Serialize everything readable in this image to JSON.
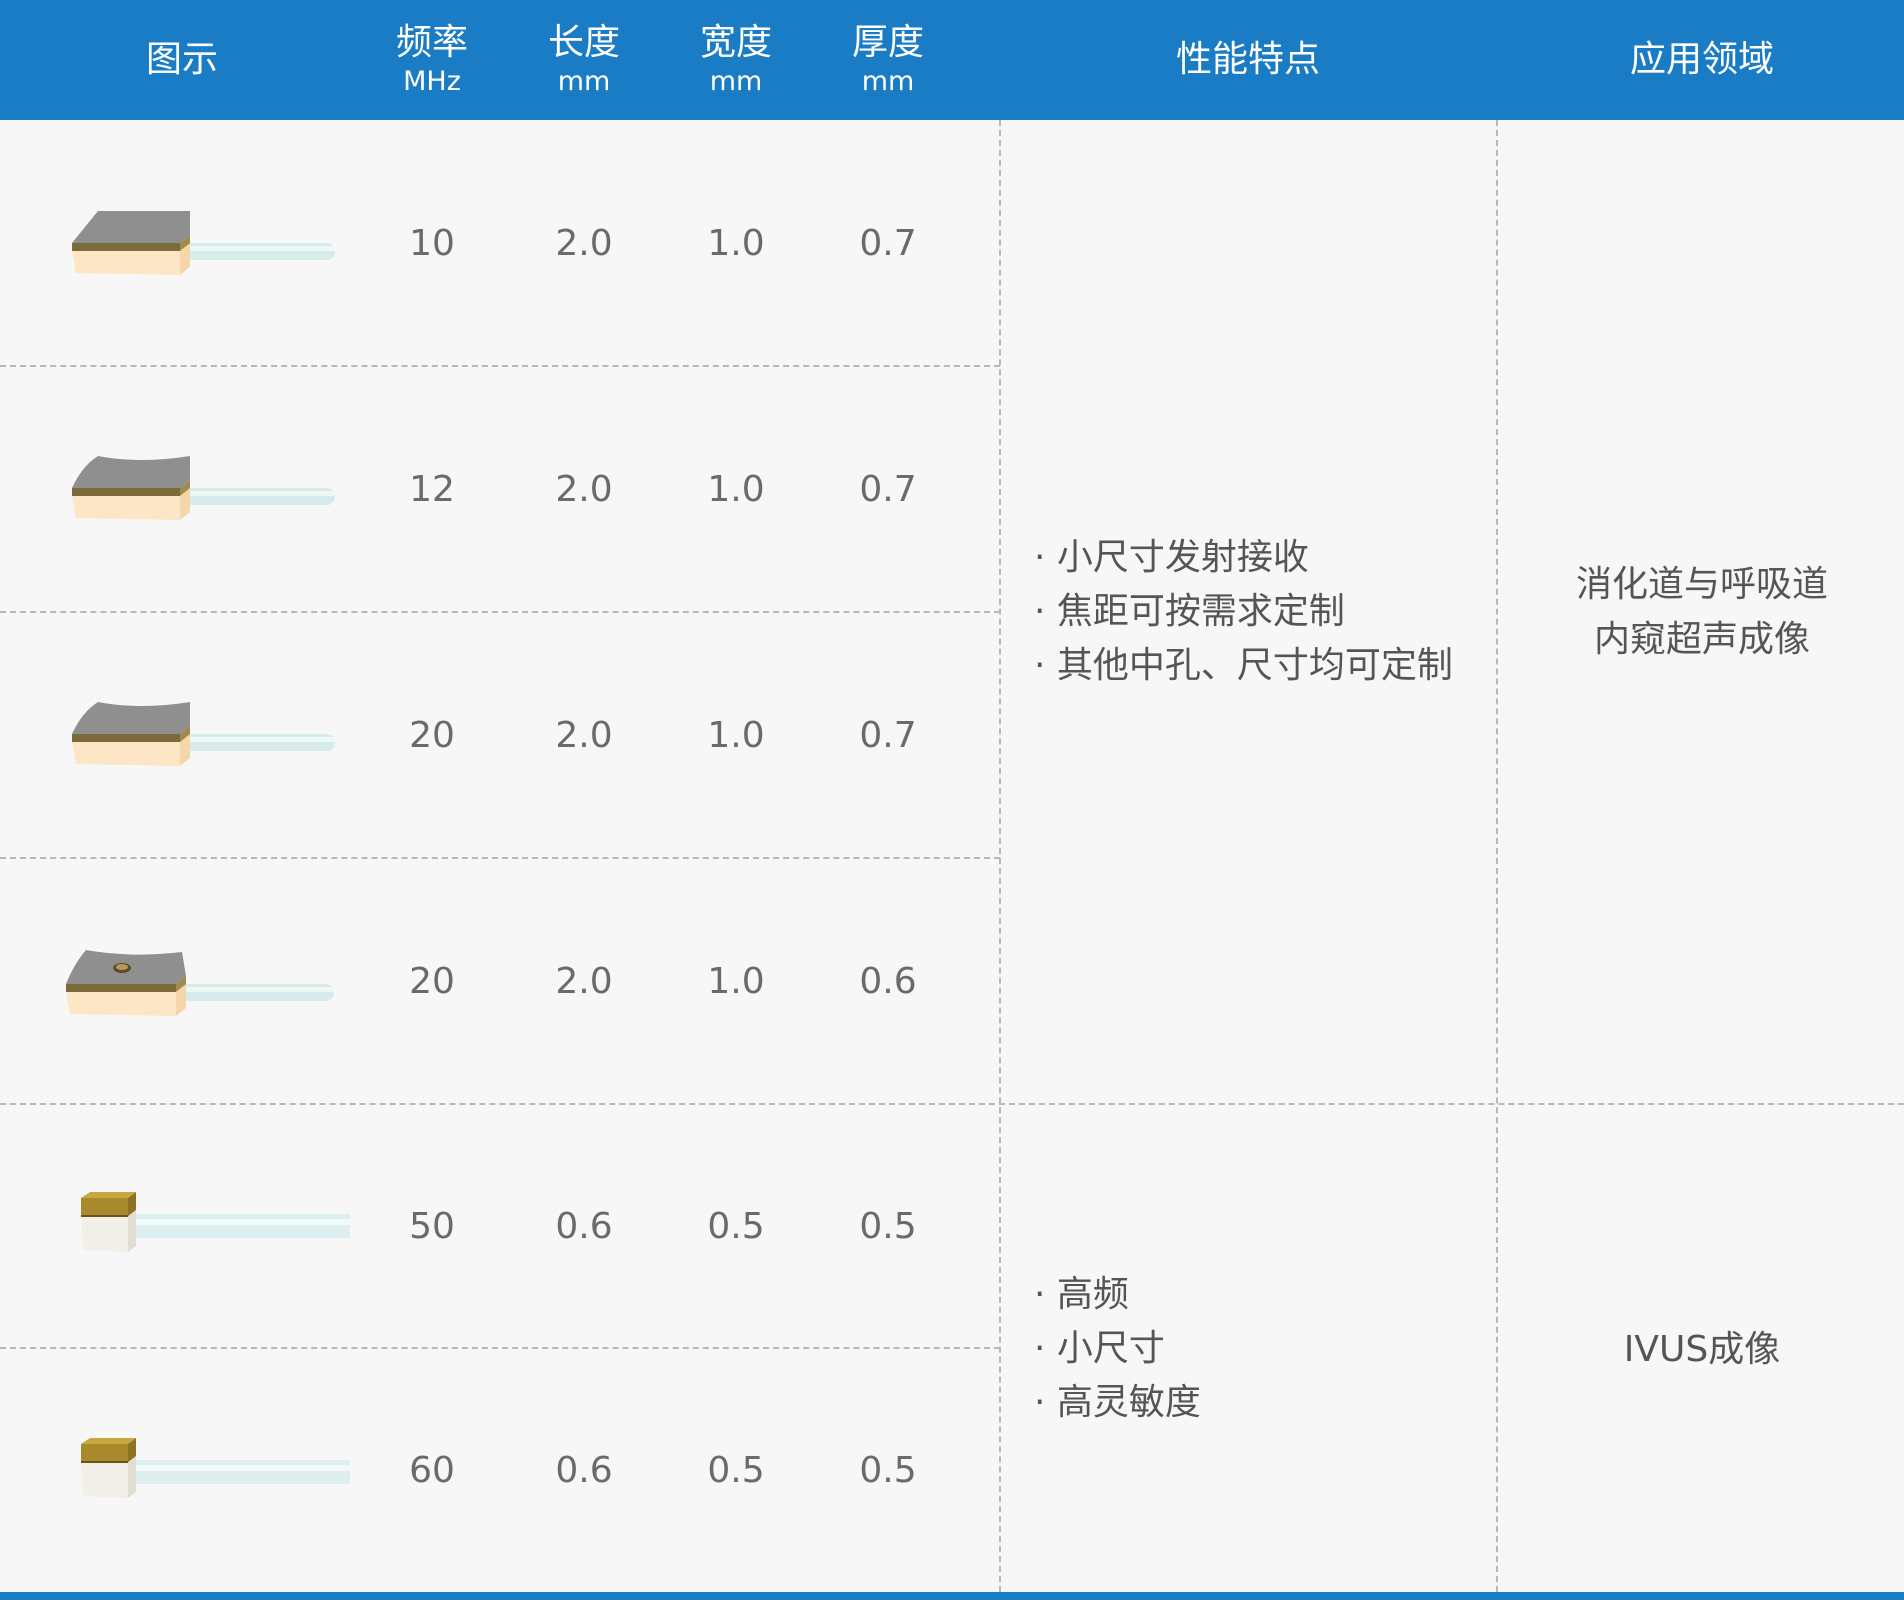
{
  "header": {
    "image": "图示",
    "frequency": "频率",
    "frequency_unit": "MHz",
    "length": "长度",
    "length_unit": "mm",
    "width": "宽度",
    "width_unit": "mm",
    "thickness": "厚度",
    "thickness_unit": "mm",
    "features": "性能特点",
    "application": "应用领域"
  },
  "colors": {
    "header_bg": "#1a7cc4",
    "header_text": "#ffffff",
    "row_bg": "#f7f7f7",
    "text": "#6a6a6a"
  },
  "rows": [
    {
      "icon": "rectangular-transducer-icon",
      "frequency": "10",
      "length": "2.0",
      "width": "1.0",
      "thickness": "0.7"
    },
    {
      "icon": "rectangular-transducer-icon",
      "frequency": "12",
      "length": "2.0",
      "width": "1.0",
      "thickness": "0.7"
    },
    {
      "icon": "rectangular-transducer-icon",
      "frequency": "20",
      "length": "2.0",
      "width": "1.0",
      "thickness": "0.7"
    },
    {
      "icon": "rectangular-transducer-with-hole-icon",
      "frequency": "20",
      "length": "2.0",
      "width": "1.0",
      "thickness": "0.6"
    },
    {
      "icon": "mini-gold-transducer-icon",
      "frequency": "50",
      "length": "0.6",
      "width": "0.5",
      "thickness": "0.5"
    },
    {
      "icon": "mini-gold-transducer-icon",
      "frequency": "60",
      "length": "0.6",
      "width": "0.5",
      "thickness": "0.5"
    }
  ],
  "groups": [
    {
      "features": [
        "小尺寸发射接收",
        "焦距可按需求定制",
        "其他中孔、尺寸均可定制"
      ],
      "application": [
        "消化道与呼吸道",
        "内窥超声成像"
      ]
    },
    {
      "features": [
        "高频",
        "小尺寸",
        "高灵敏度"
      ],
      "application": [
        "IVUS成像"
      ]
    }
  ]
}
